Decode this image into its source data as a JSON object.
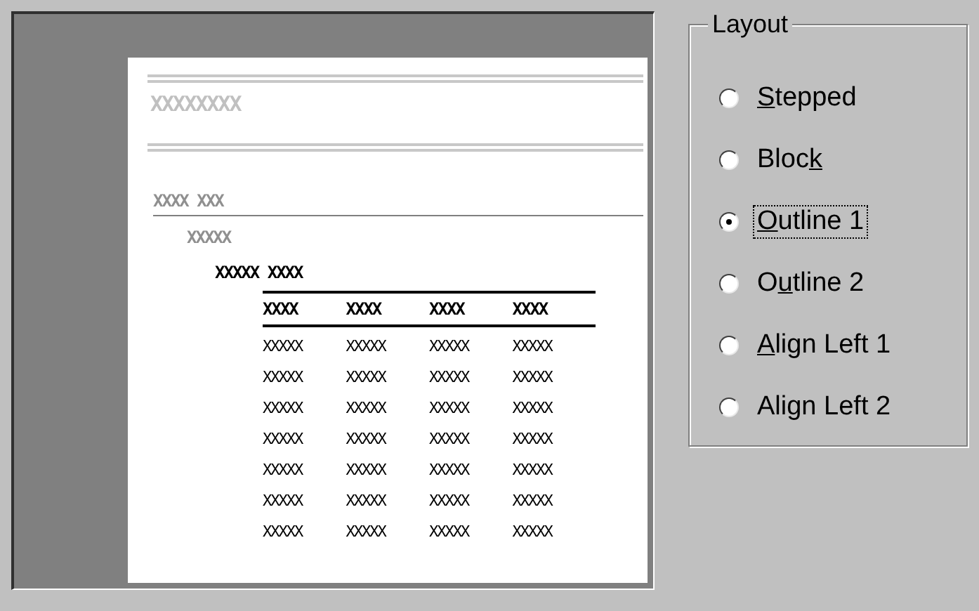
{
  "preview": {
    "title": "XXXXXXXX",
    "group_header": "XXXX XXX",
    "sub_header": "XXXXX",
    "detail_header": "XXXXX XXXX",
    "table": {
      "columns": [
        "XXXX",
        "XXXX",
        "XXXX",
        "XXXX"
      ],
      "rows": [
        [
          "XXXXX",
          "XXXXX",
          "XXXXX",
          "XXXXX"
        ],
        [
          "XXXXX",
          "XXXXX",
          "XXXXX",
          "XXXXX"
        ],
        [
          "XXXXX",
          "XXXXX",
          "XXXXX",
          "XXXXX"
        ],
        [
          "XXXXX",
          "XXXXX",
          "XXXXX",
          "XXXXX"
        ],
        [
          "XXXXX",
          "XXXXX",
          "XXXXX",
          "XXXXX"
        ],
        [
          "XXXXX",
          "XXXXX",
          "XXXXX",
          "XXXXX"
        ],
        [
          "XXXXX",
          "XXXXX",
          "XXXXX",
          "XXXXX"
        ]
      ]
    }
  },
  "layout_group": {
    "title": "Layout",
    "options": [
      {
        "key": "S",
        "after": "tepped",
        "selected": false,
        "focused": false
      },
      {
        "before": "Bloc",
        "key": "k",
        "selected": false,
        "focused": false
      },
      {
        "key": "O",
        "after": "utline 1",
        "selected": true,
        "focused": true
      },
      {
        "before": "O",
        "key": "u",
        "after": "tline 2",
        "selected": false,
        "focused": false
      },
      {
        "key": "A",
        "after": "lign Left 1",
        "selected": false,
        "focused": false
      },
      {
        "before": "Align Left 2",
        "selected": false,
        "focused": false
      }
    ]
  }
}
